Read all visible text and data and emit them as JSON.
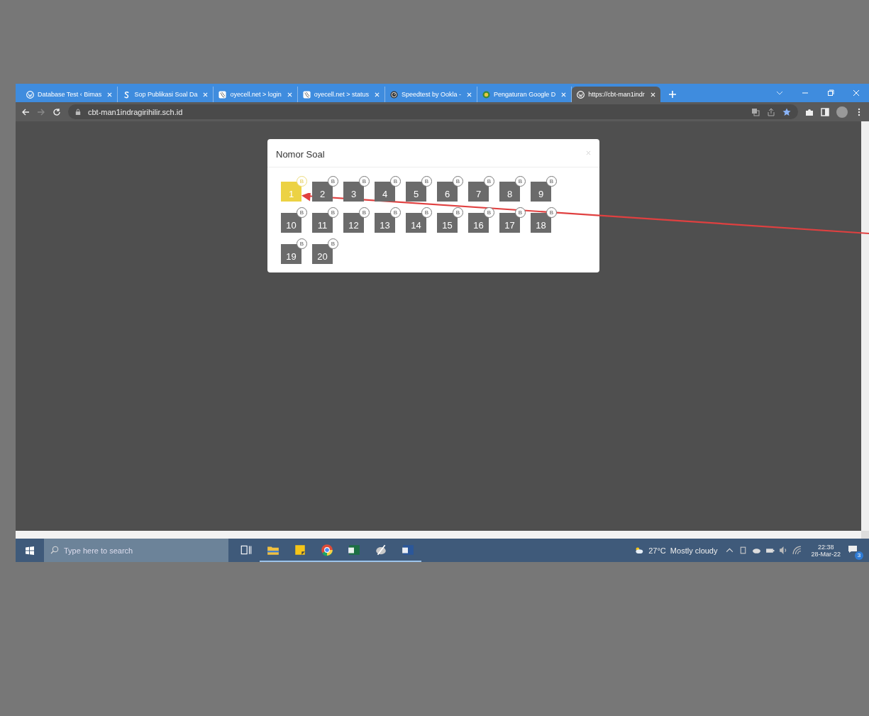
{
  "browser": {
    "tabs": [
      {
        "title": "Database Test ‹ Bimas",
        "kind": "wordpress",
        "selected": false
      },
      {
        "title": "Sop Publikasi Soal Da",
        "kind": "sheet",
        "selected": false
      },
      {
        "title": "oyecell.net > login",
        "kind": "wave",
        "selected": false
      },
      {
        "title": "oyecell.net > status",
        "kind": "wave",
        "selected": false
      },
      {
        "title": "Speedtest by Ookla -",
        "kind": "gauge",
        "selected": false
      },
      {
        "title": "Pengaturan Google D",
        "kind": "emblem",
        "selected": false
      },
      {
        "title": "https://cbt-man1indr",
        "kind": "wordpress",
        "selected": true
      }
    ],
    "address": "cbt-man1indragirihilir.sch.id"
  },
  "modal": {
    "title": "Nomor Soal",
    "questions": [
      {
        "label": "1",
        "badge": "B",
        "selected": true
      },
      {
        "label": "2",
        "badge": "B",
        "selected": false
      },
      {
        "label": "3",
        "badge": "B",
        "selected": false
      },
      {
        "label": "4",
        "badge": "B",
        "selected": false
      },
      {
        "label": "5",
        "badge": "B",
        "selected": false
      },
      {
        "label": "6",
        "badge": "B",
        "selected": false
      },
      {
        "label": "7",
        "badge": "B",
        "selected": false
      },
      {
        "label": "8",
        "badge": "B",
        "selected": false
      },
      {
        "label": "9",
        "badge": "B",
        "selected": false
      },
      {
        "label": "10",
        "badge": "B",
        "selected": false
      },
      {
        "label": "11",
        "badge": "B",
        "selected": false
      },
      {
        "label": "12",
        "badge": "B",
        "selected": false
      },
      {
        "label": "13",
        "badge": "B",
        "selected": false
      },
      {
        "label": "14",
        "badge": "B",
        "selected": false
      },
      {
        "label": "15",
        "badge": "B",
        "selected": false
      },
      {
        "label": "16",
        "badge": "B",
        "selected": false
      },
      {
        "label": "17",
        "badge": "B",
        "selected": false
      },
      {
        "label": "18",
        "badge": "B",
        "selected": false
      },
      {
        "label": "19",
        "badge": "B",
        "selected": false
      },
      {
        "label": "20",
        "badge": "B",
        "selected": false
      }
    ]
  },
  "taskbar": {
    "search": {
      "placeholder": "Type here to search"
    },
    "apps": [
      {
        "kind": "taskview",
        "running": false
      },
      {
        "kind": "folder",
        "running": true
      },
      {
        "kind": "note",
        "running": true
      },
      {
        "kind": "chrome",
        "running": true
      },
      {
        "kind": "excel",
        "running": true
      },
      {
        "kind": "paint",
        "running": true
      },
      {
        "kind": "word",
        "running": true
      }
    ],
    "weather": "27°C  Mostly cloudy",
    "time": "22:38",
    "date": "28-Mar-22",
    "notifications": "3"
  }
}
